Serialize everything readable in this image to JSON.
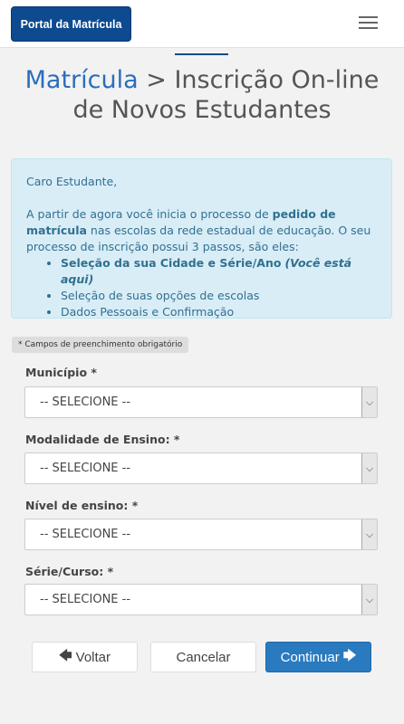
{
  "header": {
    "brand": "Portal da Matrícula",
    "menu_icon": "hamburger-menu-icon"
  },
  "page": {
    "breadcrumb_link": "Matrícula",
    "separator": ">",
    "title_line1": "Inscrição On-line",
    "title_line2": "de Novos Estudantes"
  },
  "info": {
    "greeting": "Caro Estudante,",
    "intro_pre": "A partir de agora você inicia o processo de ",
    "intro_bold": "pedido de matrícula",
    "intro_post": " nas escolas da rede estadual de educação. O seu processo de inscrição possui 3 passos, são eles:",
    "steps": [
      {
        "bold": "Seleção da sua Cidade e Série/Ano",
        "note": "(Você está aqui)"
      },
      {
        "text": "Seleção de suas opções de escolas"
      },
      {
        "text": "Dados Pessoais e Confirmação"
      }
    ]
  },
  "form": {
    "required_note": "* Campos de preenchimento obrigatório",
    "fields": [
      {
        "label": "Município *",
        "value": "-- SELECIONE --"
      },
      {
        "label": "Modalidade de Ensino: *",
        "value": "-- SELECIONE --"
      },
      {
        "label": "Nível de ensino: *",
        "value": "-- SELECIONE --"
      },
      {
        "label": "Série/Curso: *",
        "value": "-- SELECIONE --"
      }
    ]
  },
  "actions": {
    "back": "Voltar",
    "cancel": "Cancelar",
    "continue": "Continuar"
  },
  "colors": {
    "brand": "#0d4a8f",
    "link": "#2a6ebb",
    "info_bg": "#d9edf7",
    "info_text": "#31708f",
    "primary": "#2a7ac0"
  }
}
